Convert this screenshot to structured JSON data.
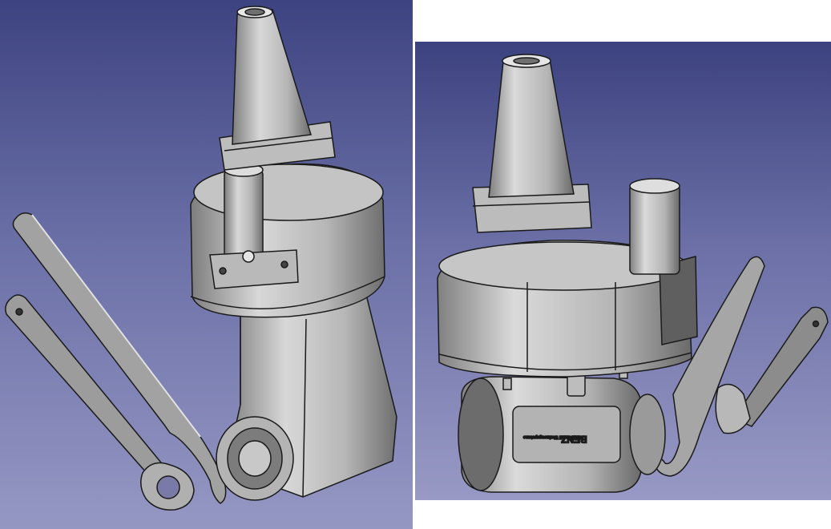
{
  "viewports": [
    {
      "name": "left-3d-view"
    },
    {
      "name": "right-3d-view"
    }
  ],
  "housing_engraving": {
    "logo_text": "BENZ",
    "sub_text": "BENZ GmbH Werkzeugsysteme"
  },
  "colors": {
    "background_top": "#3d4380",
    "background_bottom": "#9597c3",
    "part_shade": "#a9a9a9",
    "edge": "#1a1a1a"
  }
}
